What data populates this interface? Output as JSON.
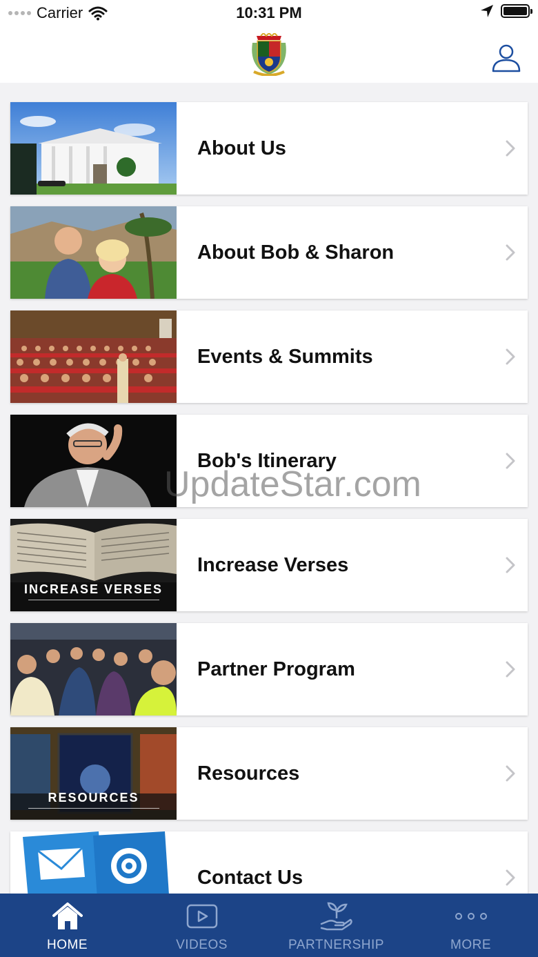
{
  "status_bar": {
    "carrier": "Carrier",
    "time": "10:31 PM"
  },
  "header": {
    "logo": "crest-logo",
    "profile_icon": "user-icon"
  },
  "menu": {
    "items": [
      {
        "label": "About Us",
        "image": "building-photo"
      },
      {
        "label": "About Bob & Sharon",
        "image": "couple-photo"
      },
      {
        "label": "Events & Summits",
        "image": "conference-hall-photo"
      },
      {
        "label": "Bob's Itinerary",
        "image": "speaker-photo"
      },
      {
        "label": "Increase Verses",
        "image": "bible-photo",
        "caption": "INCREASE VERSES"
      },
      {
        "label": "Partner Program",
        "image": "bus-group-photo"
      },
      {
        "label": "Resources",
        "image": "dvd-covers-photo",
        "caption": "RESOURCES"
      },
      {
        "label": "Contact Us",
        "image": "email-icons-photo"
      }
    ]
  },
  "watermark": "UpdateStar.com",
  "tab_bar": {
    "tabs": [
      {
        "label": "HOME",
        "icon": "home-icon",
        "active": true
      },
      {
        "label": "VIDEOS",
        "icon": "video-play-icon",
        "active": false
      },
      {
        "label": "PARTNERSHIP",
        "icon": "hand-plant-icon",
        "active": false
      },
      {
        "label": "MORE",
        "icon": "more-dots-icon",
        "active": false
      }
    ]
  },
  "colors": {
    "tab_bar": "#1c4487",
    "tab_active": "#ffffff",
    "tab_inactive": "#8fa7cf",
    "background": "#f2f2f4"
  }
}
